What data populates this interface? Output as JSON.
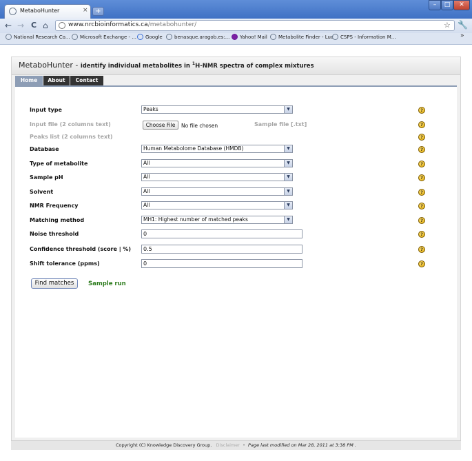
{
  "browser": {
    "tab_title": "MetaboHunter",
    "tab_close": "×",
    "new_tab": "+",
    "url_host": "www.nrcbioinformatics.ca",
    "url_path": "/metabohunter/",
    "window_buttons": {
      "minimize": "–",
      "maximize": "□",
      "close": "✕"
    },
    "nav": {
      "back": "←",
      "forward": "→",
      "reload": "C",
      "home": "⌂",
      "star": "☆",
      "wrench": "🔧"
    },
    "bookmarks": [
      {
        "label": "National Research Co...",
        "icon": "globe-icon"
      },
      {
        "label": "Microsoft Exchange - ...",
        "icon": "globe-icon"
      },
      {
        "label": "Google",
        "icon": "google-icon"
      },
      {
        "label": "benasque.aragob.es:...",
        "icon": "globe-icon"
      },
      {
        "label": "Yahoo! Mail",
        "icon": "yahoo-icon"
      },
      {
        "label": "Metabolite Finder - Luc",
        "icon": "globe-icon"
      },
      {
        "label": "CSPS - Information M...",
        "icon": "globe-icon"
      }
    ],
    "bookmarks_more": "»"
  },
  "site": {
    "brand": "MetaboHunter",
    "dash": " - ",
    "tagline_pre": "identify individual metabolites in ",
    "tagline_sup": "1",
    "tagline_post": "H-NMR spectra of complex mixtures"
  },
  "nav_tabs": {
    "home": "Home",
    "about": "About",
    "contact": "Contact"
  },
  "form": {
    "input_type": {
      "label": "Input type",
      "value": "Peaks"
    },
    "input_file": {
      "label": "Input file (2 columns text)",
      "button": "Choose File",
      "status": "No file chosen",
      "sample_link": "Sample file [.txt]"
    },
    "peaks_list": {
      "label": "Peaks list (2 columns text)"
    },
    "database": {
      "label": "Database",
      "value": "Human Metabolome Database (HMDB)"
    },
    "metabolite_type": {
      "label": "Type of metabolite",
      "value": "All"
    },
    "sample_ph": {
      "label": "Sample pH",
      "value": "All"
    },
    "solvent": {
      "label": "Solvent",
      "value": "All"
    },
    "nmr_frequency": {
      "label": "NMR Frequency",
      "value": "All"
    },
    "matching_method": {
      "label": "Matching method",
      "value": "MH1: Highest number of matched peaks"
    },
    "noise_threshold": {
      "label": "Noise threshold",
      "value": "0"
    },
    "confidence_threshold": {
      "label": "Confidence threshold (score | %)",
      "value": "0.5"
    },
    "shift_tolerance": {
      "label": "Shift tolerance (ppms)",
      "value": "0"
    },
    "help_glyph": "?",
    "select_arrow": "▼",
    "find_button": "Find matches",
    "sample_run": "Sample run"
  },
  "footer": {
    "copyright": "Copyright (C) Knowledge Discovery Group.",
    "disclaimer": "Disclaimer",
    "separator": "•",
    "modified": "Page last modified on Mar 28, 2011 at 3:38 PM ."
  }
}
